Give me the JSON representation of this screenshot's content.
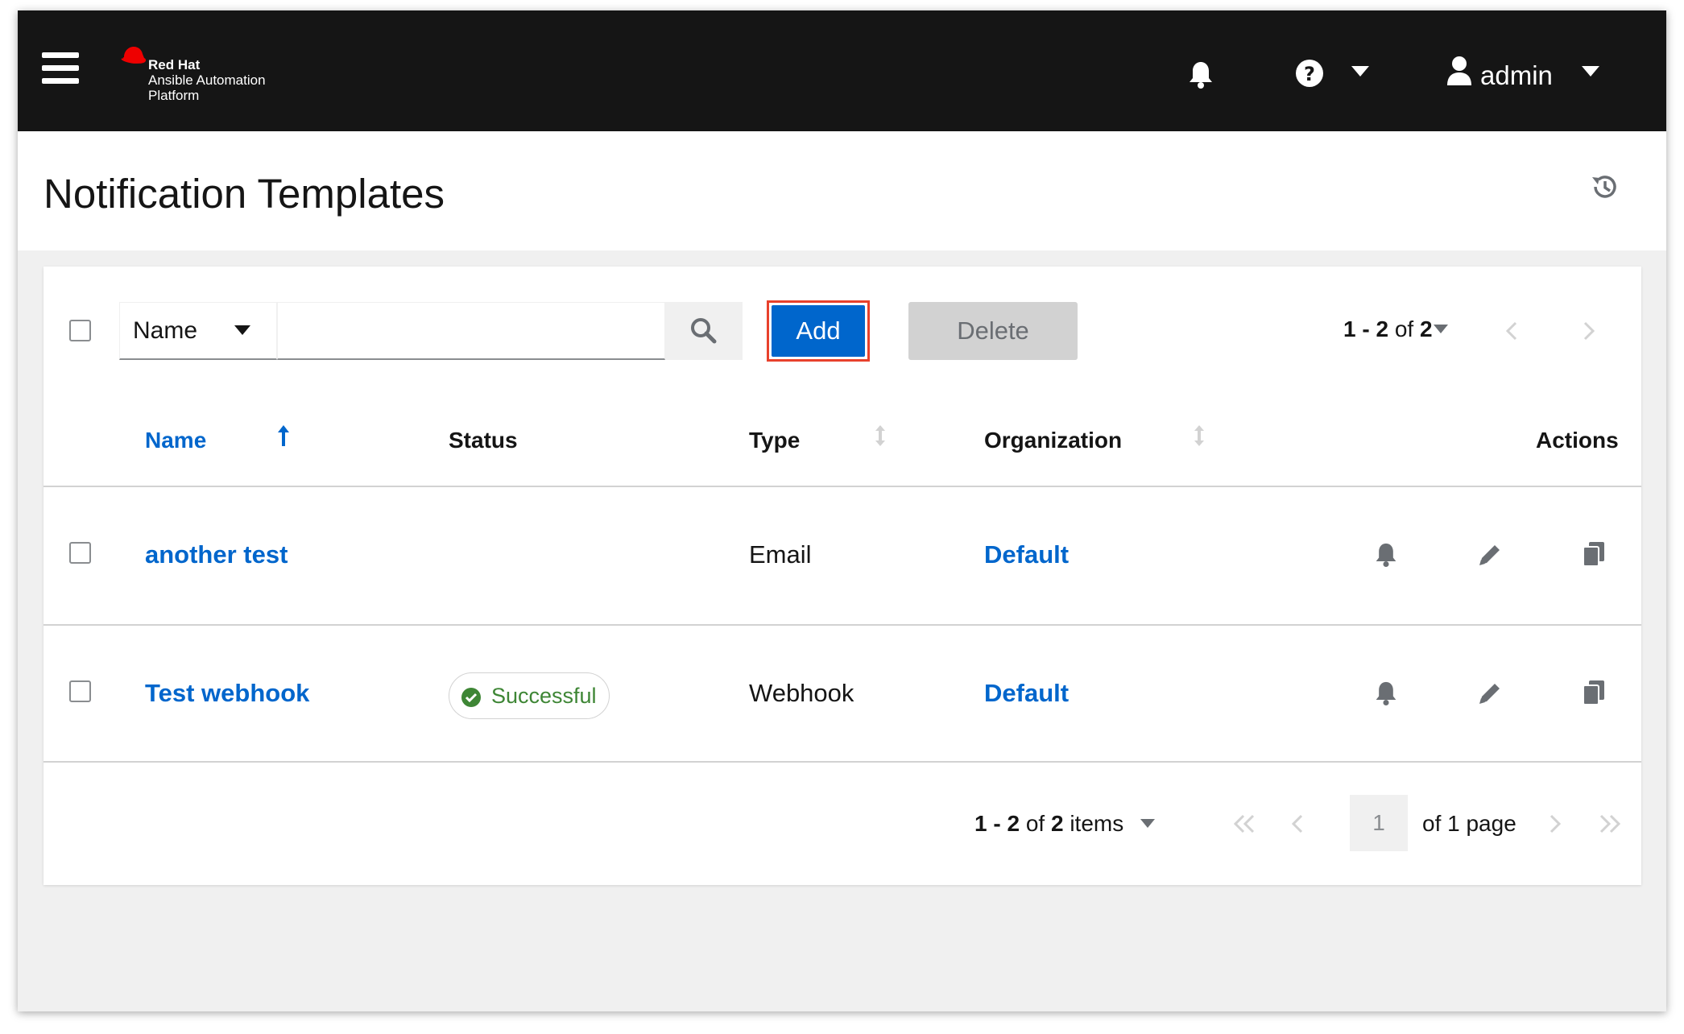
{
  "masthead": {
    "brand_line1": "Red Hat",
    "brand_line2": "Ansible Automation",
    "brand_line3": "Platform",
    "user_name": "admin",
    "icons": [
      "hamburger-icon",
      "redhat-logo",
      "bell-icon",
      "help-icon",
      "caret-down-icon",
      "user-icon"
    ]
  },
  "page": {
    "title": "Notification Templates"
  },
  "toolbar": {
    "filter_label": "Name",
    "search_value": "",
    "add_label": "Add",
    "delete_label": "Delete",
    "pager_range": "1 - 2",
    "pager_of": "of",
    "pager_total": "2"
  },
  "table": {
    "headers": {
      "name": "Name",
      "status": "Status",
      "type": "Type",
      "organization": "Organization",
      "actions": "Actions"
    },
    "rows": [
      {
        "name": "another test",
        "status": "",
        "type": "Email",
        "organization": "Default"
      },
      {
        "name": "Test webhook",
        "status": "Successful",
        "type": "Webhook",
        "organization": "Default"
      }
    ]
  },
  "pagination": {
    "range": "1 - 2",
    "of": "of",
    "total": "2",
    "items_label": "items",
    "current_page": "1",
    "of_pages": "of 1 page"
  },
  "colors": {
    "masthead_bg": "#151515",
    "link_blue": "#0066cc",
    "success_green": "#3e8635",
    "highlight_red": "#e8412c",
    "disabled_gray": "#d2d2d2"
  }
}
